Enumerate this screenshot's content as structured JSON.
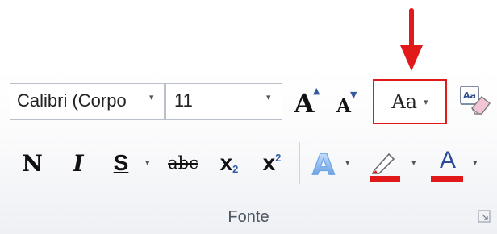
{
  "font_group": {
    "label": "Fonte",
    "font_name": "Calibri (Corpo",
    "font_size": "11",
    "dropdown_glyph": "▾",
    "grow_font_glyph": "A",
    "shrink_font_glyph": "A",
    "change_case_glyph": "Aa",
    "bold_glyph": "N",
    "italic_glyph": "I",
    "underline_glyph": "S",
    "strike_glyph": "abc",
    "subscript_glyph": "x",
    "subscript_mark": "2",
    "superscript_glyph": "x",
    "superscript_mark": "2",
    "effects_glyph": "A",
    "font_color_glyph": "A",
    "highlight_color": "#e2191b",
    "font_color": "#e2191b",
    "accent": "#e2191b"
  }
}
